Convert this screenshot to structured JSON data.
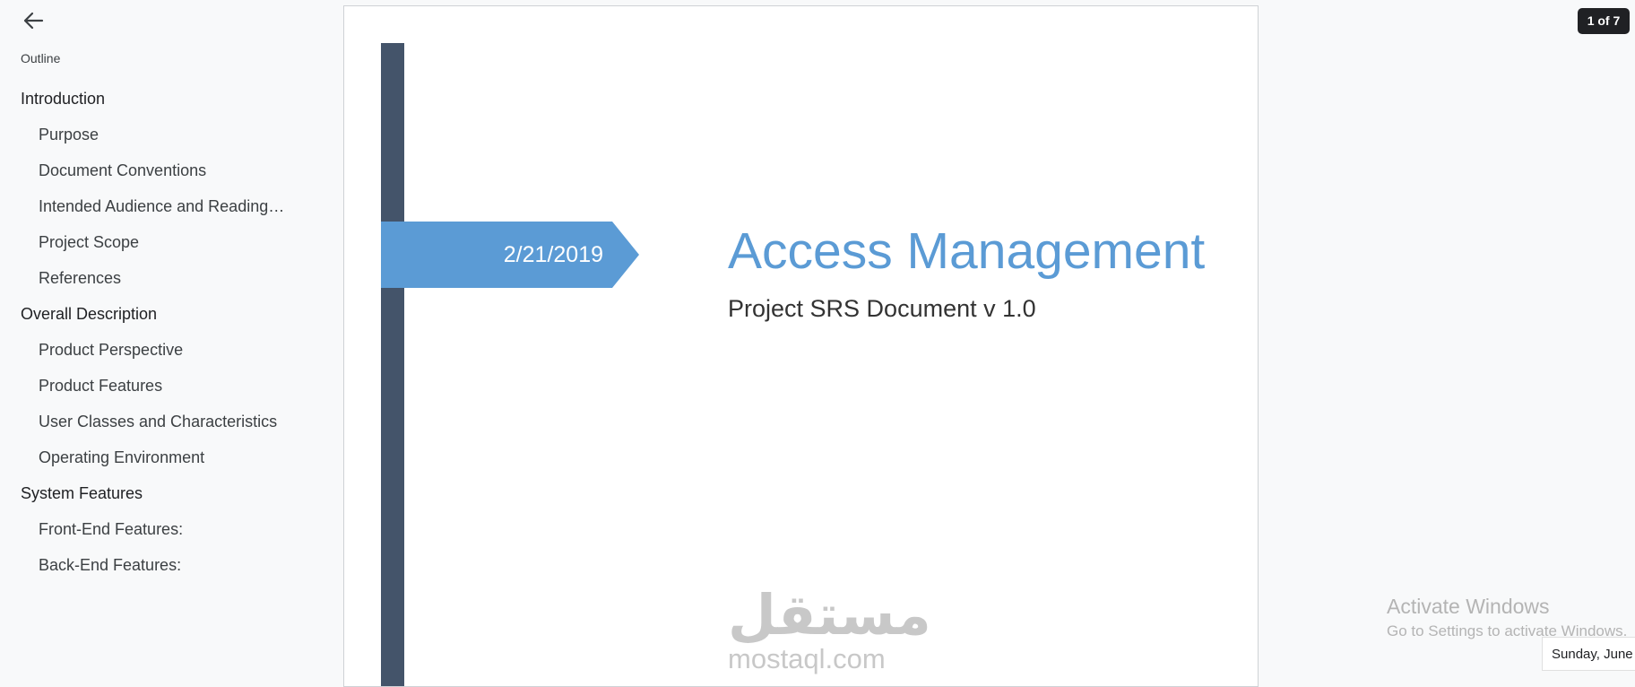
{
  "outline": {
    "heading": "Outline",
    "items": [
      {
        "label": "Introduction",
        "level": 1
      },
      {
        "label": "Purpose",
        "level": 2
      },
      {
        "label": "Document Conventions",
        "level": 2
      },
      {
        "label": "Intended Audience and Reading …",
        "level": 2
      },
      {
        "label": "Project Scope",
        "level": 2
      },
      {
        "label": "References",
        "level": 2
      },
      {
        "label": "Overall Description",
        "level": 1
      },
      {
        "label": "Product Perspective",
        "level": 2
      },
      {
        "label": "Product Features",
        "level": 2
      },
      {
        "label": "User Classes and Characteristics",
        "level": 2
      },
      {
        "label": "Operating Environment",
        "level": 2
      },
      {
        "label": "System Features",
        "level": 1
      },
      {
        "label": "Front-End Features:",
        "level": 2
      },
      {
        "label": "Back-End Features:",
        "level": 2
      }
    ]
  },
  "document": {
    "date": "2/21/2019",
    "title": "Access Management",
    "subtitle": "Project SRS Document v 1.0",
    "watermark_arabic": "مستقل",
    "watermark_latin": "mostaql.com"
  },
  "page_counter": "1 of 7",
  "system": {
    "activate_title": "Activate Windows",
    "activate_sub": "Go to Settings to activate Windows.",
    "date_tooltip": "Sunday, June"
  },
  "colors": {
    "accent_blue": "#5b9bd5",
    "bar_slate": "#44546a",
    "counter_bg": "#202124"
  },
  "icons": {
    "back": "arrow-left-icon"
  }
}
